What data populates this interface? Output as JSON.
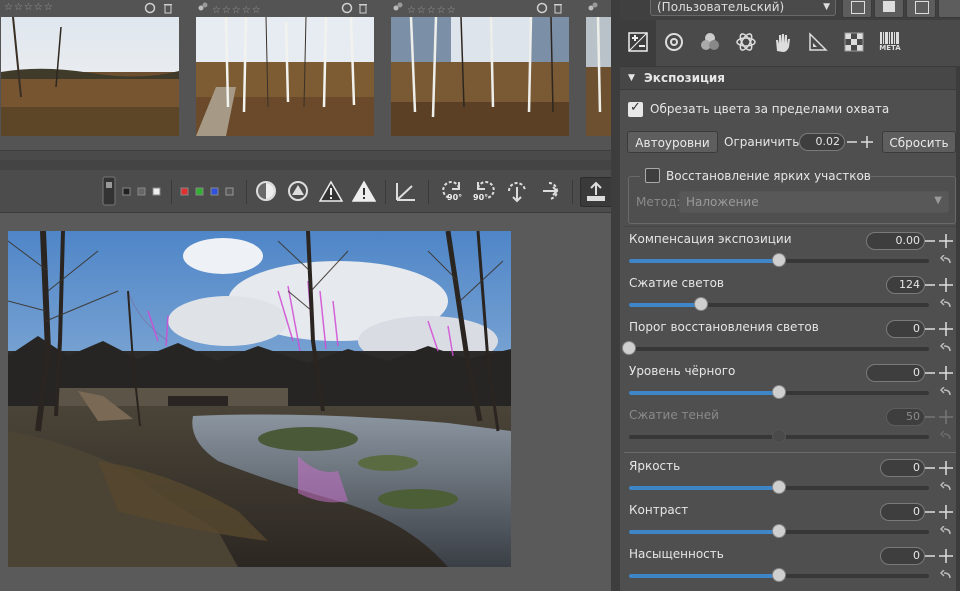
{
  "filmstrip": {
    "thumbs": [
      {
        "stars": "☆☆☆☆☆"
      },
      {
        "stars": "☆☆☆☆☆"
      },
      {
        "stars": "☆☆☆☆☆"
      },
      {
        "stars": "☆☆☆☆☆"
      }
    ]
  },
  "toolbar": {
    "icons": [
      "preview-mode-icon",
      "clipping-focus-icon",
      "highlight-clip-icon",
      "shadow-clip-icon",
      "warning-triangle-icon",
      "warning-triangle-outline-icon",
      "straighten-icon",
      "rotate-left-icon",
      "rotate-right-icon",
      "flip-horizontal-icon",
      "flip-vertical-icon",
      "export-icon"
    ],
    "rotate_left_label": "90°",
    "rotate_right_label": "90°"
  },
  "profile": {
    "value": "(Пользовательский)"
  },
  "tabs": {
    "meta_label": "META"
  },
  "exposure": {
    "section_title": "Экспозиция",
    "clip_colors_label": "Обрезать цвета за пределами охвата",
    "autolevels_label": "Автоуровни",
    "limit_label": "Ограничить",
    "limit_value": "0.02",
    "reset_label": "Сбросить",
    "highlight_recovery_label": "Восстановление ярких участков",
    "method_label": "Метод:",
    "method_value": "Наложение",
    "sliders": [
      {
        "label": "Компенсация экспозиции",
        "value": "0.00",
        "fraction": 0.5,
        "enabled": true
      },
      {
        "label": "Сжатие светов",
        "value": "124",
        "fraction": 0.24,
        "enabled": true
      },
      {
        "label": "Порог восстановления светов",
        "value": "0",
        "fraction": 0.0,
        "enabled": true
      },
      {
        "label": "Уровень чёрного",
        "value": "0",
        "fraction": 0.5,
        "enabled": true
      },
      {
        "label": "Сжатие теней",
        "value": "50",
        "fraction": 0.5,
        "enabled": false
      },
      {
        "label": "Яркость",
        "value": "0",
        "fraction": 0.5,
        "enabled": true
      },
      {
        "label": "Контраст",
        "value": "0",
        "fraction": 0.5,
        "enabled": true
      },
      {
        "label": "Насыщенность",
        "value": "0",
        "fraction": 0.5,
        "enabled": true
      }
    ]
  },
  "colors": {
    "accent": "#3f86c9",
    "panel": "#4f4f4f",
    "background": "#565656"
  }
}
